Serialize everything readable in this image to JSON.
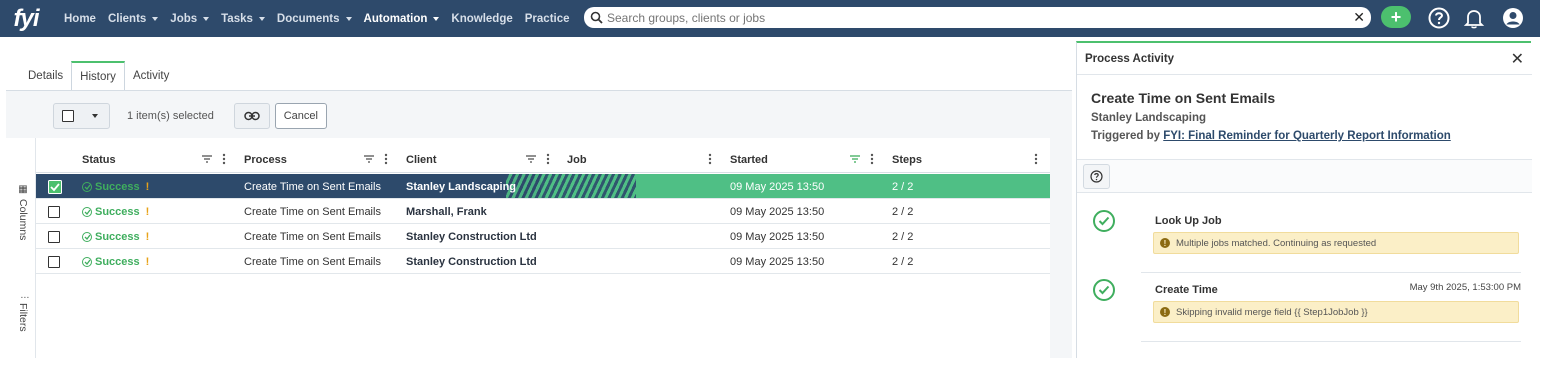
{
  "app": {
    "logo_text": "fyi",
    "nav": [
      {
        "label": "Home",
        "dropdown": false,
        "active": false
      },
      {
        "label": "Clients",
        "dropdown": true,
        "active": false
      },
      {
        "label": "Jobs",
        "dropdown": true,
        "active": false
      },
      {
        "label": "Tasks",
        "dropdown": true,
        "active": false
      },
      {
        "label": "Documents",
        "dropdown": true,
        "active": false
      },
      {
        "label": "Automation",
        "dropdown": true,
        "active": true
      },
      {
        "label": "Knowledge",
        "dropdown": false,
        "active": false
      },
      {
        "label": "Practice",
        "dropdown": false,
        "active": false
      }
    ],
    "search": {
      "placeholder": "Search groups, clients or jobs",
      "value": ""
    },
    "icons": [
      "search-icon",
      "clear-icon",
      "add-icon",
      "help-icon",
      "bell-icon",
      "user-icon"
    ],
    "colors": {
      "nav_bg": "#2e4a6b",
      "accent_green": "#4cc06e",
      "selected_row": "#2d4a6b"
    }
  },
  "main": {
    "tabs": [
      {
        "label": "Details",
        "active": false
      },
      {
        "label": "History",
        "active": true
      },
      {
        "label": "Activity",
        "active": false
      }
    ],
    "toolbar": {
      "selected_text": "1 item(s) selected",
      "cancel_label": "Cancel"
    },
    "side": {
      "columns_label": "Columns",
      "filters_label": "Filters"
    },
    "grid": {
      "columns": [
        "Status",
        "Process",
        "Client",
        "Job",
        "Started",
        "Steps"
      ],
      "rows": [
        {
          "checked": true,
          "status": "Success",
          "warning": "!",
          "process": "Create Time on Sent Emails",
          "client": "Stanley Landscaping",
          "job": "",
          "started": "09 May 2025 13:50",
          "steps": "2 / 2"
        },
        {
          "checked": false,
          "status": "Success",
          "warning": "!",
          "process": "Create Time on Sent Emails",
          "client": "Marshall, Frank",
          "job": "",
          "started": "09 May 2025 13:50",
          "steps": "2 / 2"
        },
        {
          "checked": false,
          "status": "Success",
          "warning": "!",
          "process": "Create Time on Sent Emails",
          "client": "Stanley Construction Ltd",
          "job": "",
          "started": "09 May 2025 13:50",
          "steps": "2 / 2"
        },
        {
          "checked": false,
          "status": "Success",
          "warning": "!",
          "process": "Create Time on Sent Emails",
          "client": "Stanley Construction Ltd",
          "job": "",
          "started": "09 May 2025 13:50",
          "steps": "2 / 2"
        }
      ]
    }
  },
  "panel": {
    "title": "Process Activity",
    "process_name": "Create Time on Sent Emails",
    "client": "Stanley Landscaping",
    "triggered_prefix": "Triggered by",
    "triggered_link": "FYI: Final Reminder for Quarterly Report Information",
    "steps": [
      {
        "name": "Look Up Job",
        "time": "",
        "note": "Multiple jobs matched. Continuing as requested"
      },
      {
        "name": "Create Time",
        "time": "May 9th 2025, 1:53:00 PM",
        "note": "Skipping invalid merge field {{ Step1JobJob }}"
      }
    ]
  }
}
